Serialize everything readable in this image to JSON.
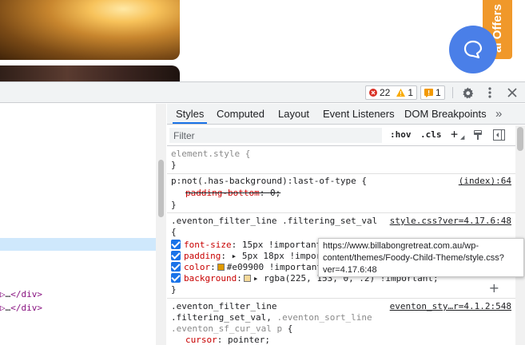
{
  "page": {
    "side_tab_label": "al Offers",
    "chat_button_label": "chat"
  },
  "toolbar": {
    "errors": "22",
    "warnings": "1",
    "messages": "1"
  },
  "elements": {
    "lines": [
      {
        "open": "▷",
        "dots": "…",
        "close": "</div>"
      },
      {
        "open": "▷",
        "dots": "…",
        "close": "</div>"
      }
    ]
  },
  "tabs": [
    "Styles",
    "Computed",
    "Layout",
    "Event Listeners",
    "DOM Breakpoints"
  ],
  "tabs_more": "»",
  "filter": {
    "placeholder": "Filter",
    "hov": ":hov",
    "cls": ".cls",
    "add": "+"
  },
  "rules": {
    "r1": {
      "selector": "element.style {",
      "close": "}"
    },
    "r2": {
      "selector": "p:not(.has-background):last-of-type {",
      "source": "(index):64",
      "prop": "padding-bottom",
      "value": "0;",
      "close": "}"
    },
    "r3": {
      "selector": ".eventon_filter_line .filtering_set_val",
      "source": "style.css?ver=4.17.6:48",
      "open": "{",
      "decls": [
        {
          "prop": "font-size",
          "value": "15px !important;"
        },
        {
          "prop": "padding",
          "value": "▸ 5px 18px !important;"
        },
        {
          "prop": "color",
          "value": "#e09900 !important;"
        },
        {
          "prop": "background",
          "value": "▸ rgba(225, 153, 0, .2) !important;"
        }
      ],
      "close": "}",
      "add": "+"
    },
    "r4": {
      "line1": ".eventon_filter_line",
      "line2a": ".filtering_set_val,",
      "line2b": ".eventon_sort_line",
      "line3a": ".eventon_sf_cur_val p",
      "line3b": "{",
      "source": "eventon_sty…r=4.1.2:548",
      "decl_prop": "cursor",
      "decl_value": "pointer;"
    }
  },
  "tooltip": {
    "line1": "https://www.billabongretreat.com.au/wp-",
    "line2": "content/themes/Foody-Child-Theme/style.css?",
    "line3": "ver=4.17.6:48"
  },
  "colors": {
    "accent": "#1a73e8",
    "color_swatch": "#e09900",
    "bg_swatch": "#f6d999",
    "offers_tab": "#f0982a",
    "chat_button": "#4a7fe8"
  }
}
